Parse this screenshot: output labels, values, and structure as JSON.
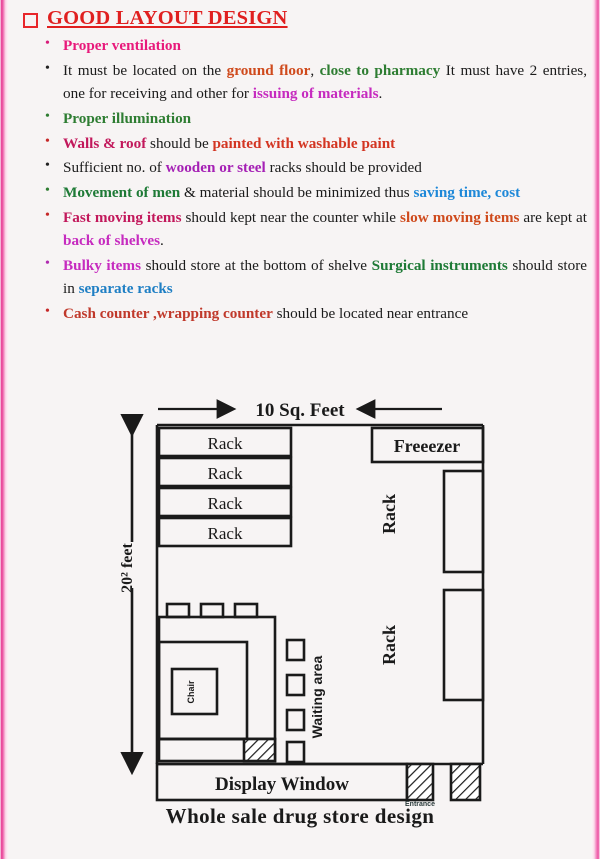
{
  "page": {
    "title": "GOOD LAYOUT DESIGN",
    "background_color": "#f7f4f4",
    "edge_stripe_color": "#e8328f",
    "title_color": "#e01f1f"
  },
  "bullets": [
    {
      "id": "proper-ventilation",
      "bullet_color": "#d81b79",
      "segments": [
        {
          "text": "Proper ventilation",
          "style": "pink"
        }
      ]
    },
    {
      "id": "ground-floor-location",
      "bullet_color": "#222222",
      "segments": [
        {
          "text": "It must be located on the ",
          "style": "plain"
        },
        {
          "text": "ground floor",
          "style": "orange"
        },
        {
          "text": ", ",
          "style": "plain"
        },
        {
          "text": "close to pharmacy",
          "style": "green"
        },
        {
          "text": " It must have 2 entries, one for receiving and other for ",
          "style": "plain"
        },
        {
          "text": "issuing of materials",
          "style": "magenta"
        },
        {
          "text": ".",
          "style": "plain"
        }
      ]
    },
    {
      "id": "proper-illumination",
      "bullet_color": "#2f7d32",
      "segments": [
        {
          "text": "Proper illumination",
          "style": "green"
        }
      ]
    },
    {
      "id": "walls-and-roof",
      "bullet_color": "#c2185b",
      "segments": [
        {
          "text": "Walls & roof",
          "style": "crimson"
        },
        {
          "text": " should be ",
          "style": "plain"
        },
        {
          "text": "painted with washable paint",
          "style": "red"
        }
      ]
    },
    {
      "id": "sufficient-racks",
      "bullet_color": "#222222",
      "segments": [
        {
          "text": "Sufficient no. of ",
          "style": "plain"
        },
        {
          "text": "wooden or steel",
          "style": "purple"
        },
        {
          "text": " racks should be provided",
          "style": "plain"
        }
      ]
    },
    {
      "id": "movement-of-men",
      "bullet_color": "#2f7d32",
      "segments": [
        {
          "text": "Movement of men",
          "style": "dgreen"
        },
        {
          "text": " & material should be minimized thus ",
          "style": "plain"
        },
        {
          "text": "saving time, cost",
          "style": "blue"
        }
      ]
    },
    {
      "id": "fast-slow-moving-items",
      "bullet_color": "#c2185b",
      "segments": [
        {
          "text": "Fast moving items",
          "style": "crimson"
        },
        {
          "text": " should kept near the counter while ",
          "style": "plain"
        },
        {
          "text": "slow moving items",
          "style": "orange"
        },
        {
          "text": " are kept at ",
          "style": "plain"
        },
        {
          "text": "back of shelves",
          "style": "magenta"
        },
        {
          "text": ".",
          "style": "plain"
        }
      ]
    },
    {
      "id": "bulky-items",
      "bullet_color": "#b02ab0",
      "segments": [
        {
          "text": "Bulky items",
          "style": "magenta"
        },
        {
          "text": " should store at the bottom of shelve ",
          "style": "plain"
        },
        {
          "text": "Surgical instruments",
          "style": "dgreen"
        },
        {
          "text": " should store in ",
          "style": "plain"
        },
        {
          "text": "separate racks",
          "style": "teal"
        }
      ]
    },
    {
      "id": "cash-counter",
      "bullet_color": "#c62828",
      "segments": [
        {
          "text": "Cash counter ,wrapping counter",
          "style": "brown"
        },
        {
          "text": " should be located near entrance",
          "style": "plain"
        }
      ]
    }
  ],
  "diagram": {
    "caption": "Whole sale drug store design",
    "width_label": "10 Sq. Feet",
    "height_label": "20² feet",
    "racks_horizontal": [
      "Rack",
      "Rack",
      "Rack",
      "Rack"
    ],
    "freezer_label": "Freeezer",
    "rack_vertical_upper": "Rack",
    "rack_vertical_lower": "Rack",
    "waiting_area_label": "Waiting area",
    "chair_label": "Chair",
    "display_window_label": "Display Window",
    "entrance_label": "Entrance",
    "line_color": "#1a1a1a"
  }
}
